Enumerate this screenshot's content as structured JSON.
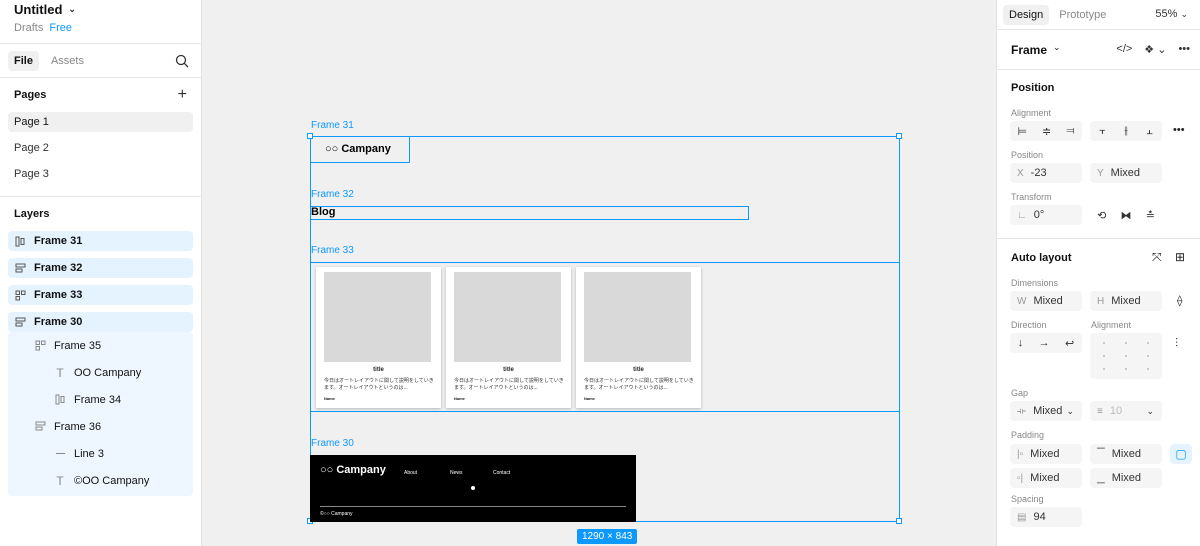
{
  "file": {
    "title": "Untitled",
    "location": "Drafts",
    "plan": "Free"
  },
  "left_tabs": {
    "file": "File",
    "assets": "Assets"
  },
  "pages": {
    "heading": "Pages",
    "items": [
      "Page 1",
      "Page 2",
      "Page 3"
    ]
  },
  "layers": {
    "heading": "Layers",
    "items": [
      {
        "name": "Frame 31"
      },
      {
        "name": "Frame 32"
      },
      {
        "name": "Frame 33"
      },
      {
        "name": "Frame 30"
      }
    ],
    "children": [
      "Frame 35",
      "OO Campany",
      "Frame 34",
      "Frame 36",
      "Line 3",
      "©OO Campany"
    ]
  },
  "canvas": {
    "labels": {
      "f31": "Frame 31",
      "f32": "Frame 32",
      "f33": "Frame 33",
      "f30": "Frame 30"
    },
    "company": "○○ Campany",
    "blog": "Blog",
    "card_title": "title",
    "card_desc": "今日はオートレイアウトに関して説明をしていきます。オートレイアウトというのは...",
    "card_name": "Name",
    "footer_logo": "○○ Campany",
    "nav": [
      "About",
      "News",
      "Contact"
    ],
    "copyright": "©○○ Campany",
    "dimensions": "1290 × 843"
  },
  "right": {
    "tabs": {
      "design": "Design",
      "prototype": "Prototype"
    },
    "zoom": "55%",
    "frame": "Frame",
    "position_title": "Position",
    "alignment_label": "Alignment",
    "position_label": "Position",
    "x_value": "-23",
    "y_value": "Mixed",
    "transform_label": "Transform",
    "rotation": "0°",
    "autolayout_title": "Auto layout",
    "dimensions_label": "Dimensions",
    "w_value": "Mixed",
    "h_value": "Mixed",
    "direction_label": "Direction",
    "alignment2_label": "Alignment",
    "gap_label": "Gap",
    "gap_value": "Mixed",
    "gap2_value": "10",
    "padding_label": "Padding",
    "pad_left": "Mixed",
    "pad_top": "Mixed",
    "pad_right": "Mixed",
    "pad_bottom": "Mixed",
    "spacing_label": "Spacing",
    "spacing_value": "94"
  },
  "colors": {
    "accent": "#0d99ff",
    "footer_bg": "#000000"
  }
}
